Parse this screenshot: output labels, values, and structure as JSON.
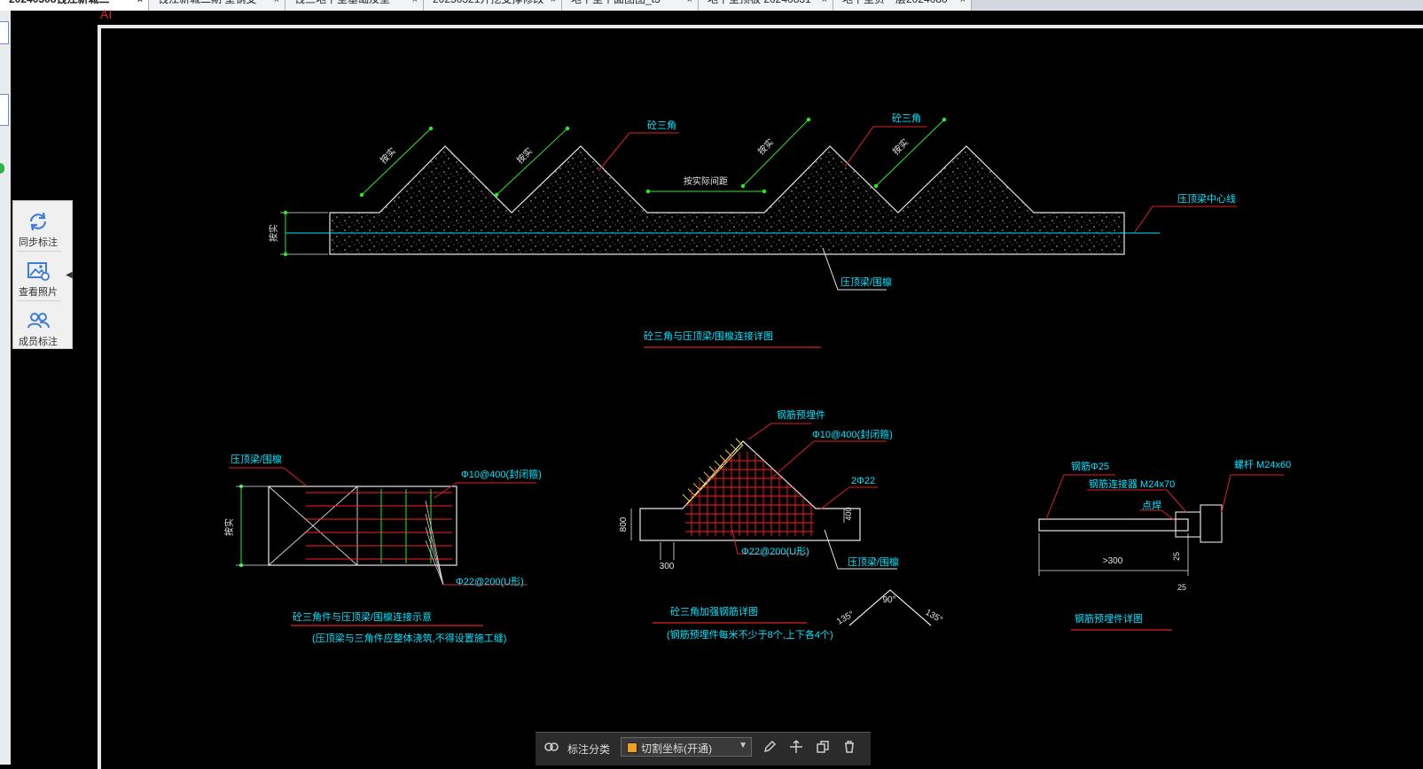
{
  "tabs": [
    {
      "label": "20240308钱江新城二",
      "active": true
    },
    {
      "label": "钱江新城二期 塑钢支",
      "active": false
    },
    {
      "label": "钱三地下室基础及垫",
      "active": false
    },
    {
      "label": "20250321开挖支撑修改",
      "active": false
    },
    {
      "label": "地下室平面图图_t3",
      "active": false
    },
    {
      "label": "地下室顶板 20240831",
      "active": false
    },
    {
      "label": "地下室负一层2024080",
      "active": false
    }
  ],
  "tab_close_glyph": "×",
  "ai_mark": "AI",
  "side_panel": {
    "items": [
      {
        "label": "同步标注",
        "icon": "sync-icon"
      },
      {
        "label": "查看照片",
        "icon": "photo-icon"
      },
      {
        "label": "成员标注",
        "icon": "members-icon"
      }
    ],
    "collapse_glyph": "◀"
  },
  "drawing": {
    "d1": {
      "label_tri1": "砼三角",
      "label_tri2": "砼三角",
      "label_dim1": "按实",
      "label_dim2": "按实",
      "label_dim3": "按实",
      "label_dim4": "按实",
      "label_gap": "按实际间距",
      "label_height": "按实",
      "label_center": "压顶梁中心线",
      "label_beam": "压顶梁/围檩",
      "title": "砼三角与压顶梁/围檩连接详图"
    },
    "d2": {
      "label_beam": "压顶梁/围檩",
      "label_stirrup": "Φ10@400(封闭箍)",
      "label_ubar": "Φ22@200(U形)",
      "label_dim": "按实",
      "title": "砼三角件与压顶梁/围檩连接示意",
      "subtitle": "(压顶梁与三角件应整体浇筑,不得设置施工缝)"
    },
    "d3": {
      "label_embed": "钢筋预埋件",
      "label_stirrup": "Φ10@400(封闭箍)",
      "label_2bar": "2Φ22",
      "label_ubar": "Φ22@200(U形)",
      "label_beam": "压顶梁/围檩",
      "dim_800": "800",
      "dim_300": "300",
      "dim_400": "400",
      "title": "砼三角加强钢筋详图",
      "subtitle": "(钢筋预埋件每米不少于8个,上下各4个)",
      "angle_90": "90°",
      "angle_135a": "135°",
      "angle_135b": "135°"
    },
    "d4": {
      "label_rebar": "钢筋Φ25",
      "label_coupler": "钢筋连接器 M24x70",
      "label_weld": "点焊",
      "label_bolt": "螺杆 M24x60",
      "dim_300": ">300",
      "dim_25": "25",
      "dim_25b": "25",
      "title": "钢筋预埋件详图"
    }
  },
  "status_bar": {
    "label": "标注分类",
    "selected": "切割坐标(开通)",
    "caret": "▼"
  },
  "colors": {
    "outline": "#e6e6e6",
    "cyan": "#00e5ff",
    "green": "#22ee22",
    "red": "#ff2020",
    "yellow": "#e0e040",
    "leader_red": "#e02020"
  }
}
